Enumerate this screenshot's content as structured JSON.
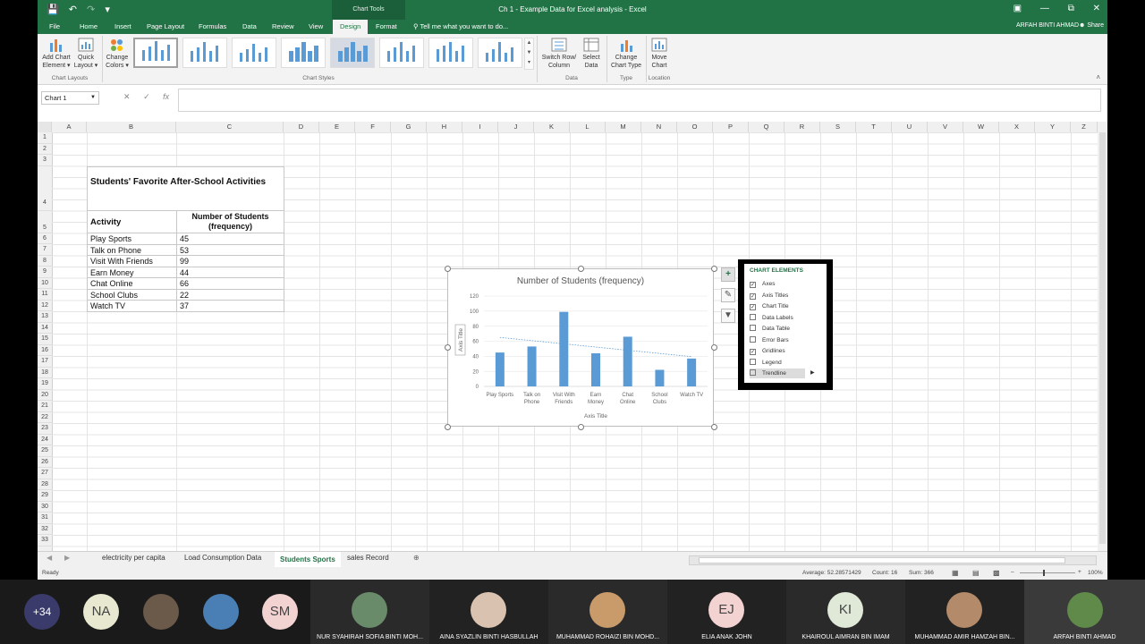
{
  "window": {
    "title": "Ch 1 - Example Data for Excel analysis - Excel",
    "chart_tools_label": "Chart Tools",
    "user": "ARFAH BINTI AHMAD",
    "share": "Share"
  },
  "tabs": [
    "File",
    "Home",
    "Insert",
    "Page Layout",
    "Formulas",
    "Data",
    "Review",
    "View",
    "Design",
    "Format"
  ],
  "active_tab": "Design",
  "tell_me": "Tell me what you want to do...",
  "ribbon": {
    "add_chart_element": [
      "Add Chart",
      "Element ▾"
    ],
    "quick_layout": [
      "Quick",
      "Layout ▾"
    ],
    "change_colors": [
      "Change",
      "Colors ▾"
    ],
    "switch_row_col": [
      "Switch Row/",
      "Column"
    ],
    "select_data": [
      "Select",
      "Data"
    ],
    "change_chart_type": [
      "Change",
      "Chart Type"
    ],
    "move_chart": [
      "Move",
      "Chart"
    ],
    "groups": {
      "chart_layouts": "Chart Layouts",
      "chart_styles": "Chart Styles",
      "data": "Data",
      "type": "Type",
      "location": "Location"
    }
  },
  "name_box": "Chart 1",
  "columns": [
    "A",
    "B",
    "C",
    "D",
    "E",
    "F",
    "G",
    "H",
    "I",
    "J",
    "K",
    "L",
    "M",
    "N",
    "O",
    "P",
    "Q",
    "R",
    "S",
    "T",
    "U",
    "V",
    "W",
    "X",
    "Y",
    "Z"
  ],
  "rows": [
    "1",
    "2",
    "3",
    "4",
    "5",
    "6",
    "7",
    "8",
    "9",
    "10",
    "11",
    "12",
    "13",
    "14",
    "15",
    "16",
    "17",
    "18",
    "19",
    "20",
    "21",
    "22",
    "23",
    "24",
    "25",
    "26",
    "27",
    "28",
    "29",
    "30",
    "31",
    "32",
    "33"
  ],
  "table": {
    "title": "Students' Favorite After-School Activities",
    "header_activity": "Activity",
    "header_count": "Number of Students (frequency)",
    "rows": [
      {
        "activity": "Play Sports",
        "count": "45"
      },
      {
        "activity": "Talk on Phone",
        "count": "53"
      },
      {
        "activity": "Visit With Friends",
        "count": "99"
      },
      {
        "activity": "Earn Money",
        "count": "44"
      },
      {
        "activity": "Chat Online",
        "count": "66"
      },
      {
        "activity": "School Clubs",
        "count": "22"
      },
      {
        "activity": "Watch TV",
        "count": "37"
      }
    ]
  },
  "chart_data": {
    "type": "bar",
    "title": "Number of Students (frequency)",
    "xlabel": "Axis Title",
    "ylabel": "Axis Title",
    "categories": [
      [
        "Play Sports"
      ],
      [
        "Talk on",
        "Phone"
      ],
      [
        "Visit With",
        "Friends"
      ],
      [
        "Earn",
        "Money"
      ],
      [
        "Chat",
        "Online"
      ],
      [
        "School",
        "Clubs"
      ],
      [
        "Watch TV"
      ]
    ],
    "values": [
      45,
      53,
      99,
      44,
      66,
      22,
      37
    ],
    "ylim": [
      0,
      120
    ],
    "yticks": [
      0,
      20,
      40,
      60,
      80,
      100,
      120
    ],
    "gridlines": true,
    "legend": "none",
    "trendline": "linear dotted",
    "bar_color": "#5b9bd5"
  },
  "chart_elements": {
    "header": "CHART ELEMENTS",
    "items": [
      {
        "label": "Axes",
        "checked": true
      },
      {
        "label": "Axis Titles",
        "checked": true
      },
      {
        "label": "Chart Title",
        "checked": true
      },
      {
        "label": "Data Labels",
        "checked": false
      },
      {
        "label": "Data Table",
        "checked": false
      },
      {
        "label": "Error Bars",
        "checked": false
      },
      {
        "label": "Gridlines",
        "checked": true
      },
      {
        "label": "Legend",
        "checked": false
      },
      {
        "label": "Trendline",
        "checked": false
      }
    ]
  },
  "sheets": [
    "electricity per capita",
    "Load Consumption Data",
    "Students Sports",
    "sales Record"
  ],
  "active_sheet": "Students Sports",
  "status": {
    "ready": "Ready",
    "average": "Average: 52.28571429",
    "count": "Count: 16",
    "sum": "Sum: 366",
    "zoom": "100%"
  },
  "participants": [
    {
      "label": "+34",
      "name": "",
      "color": "#3b3b6b"
    },
    {
      "label": "NA",
      "name": "",
      "color": "#e8e8d0"
    },
    {
      "label": "",
      "name": "",
      "color": "#6b5a4a"
    },
    {
      "label": "",
      "name": "",
      "color": "#4a7fb5"
    },
    {
      "label": "SM",
      "name": "",
      "color": "#f3d2d2"
    },
    {
      "label": "",
      "name": "NUR SYAHIRAH SOFIA BINTI MOH...",
      "color": "#6a8b6a"
    },
    {
      "label": "",
      "name": "AINA SYAZLIN BINTI HASBULLAH",
      "color": "#d9c3b0"
    },
    {
      "label": "",
      "name": "MUHAMMAD ROHAIZI BIN MOHD...",
      "color": "#c99a6a"
    },
    {
      "label": "EJ",
      "name": "ELIA ANAK JOHN",
      "color": "#f3d2d2"
    },
    {
      "label": "KI",
      "name": "KHAIROUL AIMRAN BIN IMAM",
      "color": "#e0e8d8"
    },
    {
      "label": "",
      "name": "MUHAMMAD AMIR HAMZAH BIN...",
      "color": "#b38a6a"
    },
    {
      "label": "",
      "name": "ARFAH BINTI AHMAD",
      "color": "#5f8a4a"
    }
  ]
}
